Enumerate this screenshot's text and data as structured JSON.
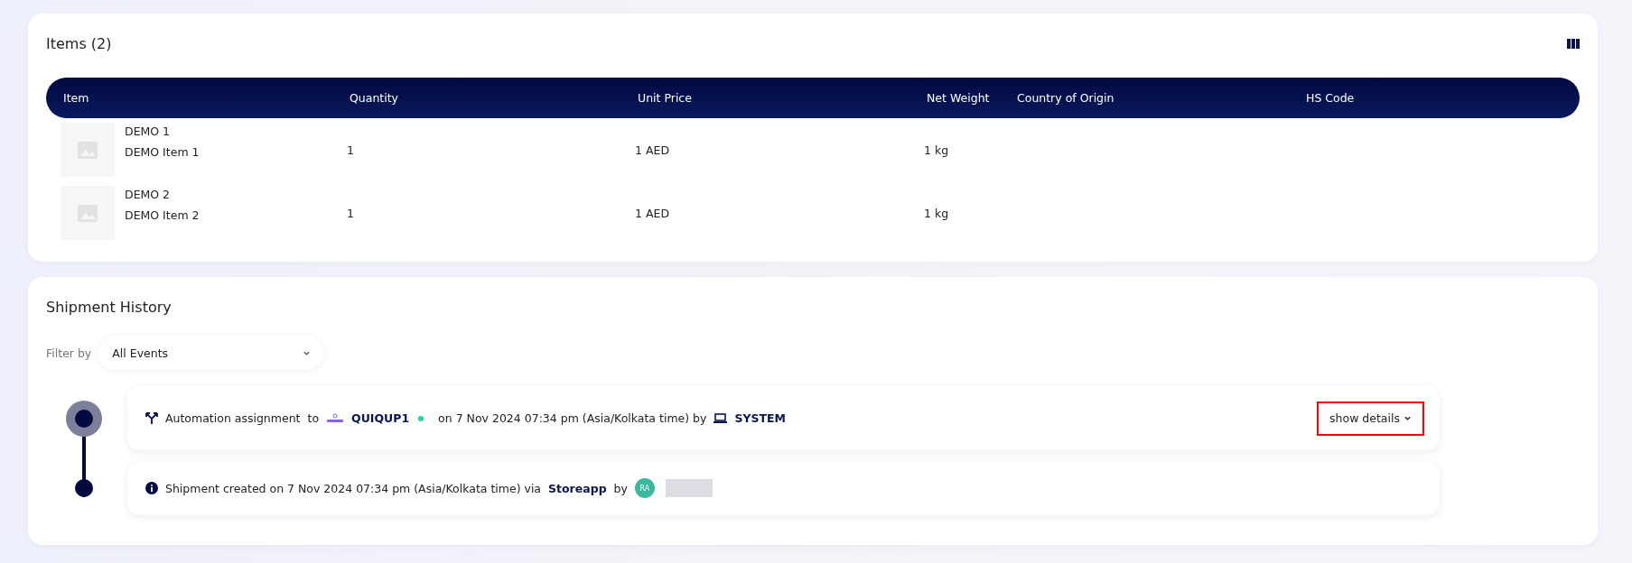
{
  "items_card": {
    "title": "Items (2)",
    "columns": [
      "Item",
      "Quantity",
      "Unit Price",
      "Net Weight",
      "Country of Origin",
      "HS Code"
    ],
    "rows": [
      {
        "sku": "DEMO 1",
        "name": "DEMO Item 1",
        "quantity": "1",
        "unit_price": "1 AED",
        "net_weight": "1 kg"
      },
      {
        "sku": "DEMO 2",
        "name": "DEMO Item 2",
        "quantity": "1",
        "unit_price": "1 AED",
        "net_weight": "1 kg"
      }
    ]
  },
  "history": {
    "title": "Shipment History",
    "filter_label": "Filter by",
    "filter_value": "All Events",
    "events": [
      {
        "kind": "assignment",
        "active": true,
        "action": "Automation assignment",
        "to": "to",
        "carrier": "QUIQUP1",
        "color": "#22d39b",
        "when": "on  7 Nov 2024 07:34 pm (Asia/Kolkata time) by",
        "actor": "SYSTEM",
        "details_button": {
          "label": "show details",
          "highlighted": true
        }
      },
      {
        "kind": "created",
        "active": false,
        "text": "Shipment created on 7 Nov 2024 07:34 pm (Asia/Kolkata time) via",
        "source": "Storeapp",
        "by": "by",
        "avatar": "RA"
      }
    ]
  }
}
